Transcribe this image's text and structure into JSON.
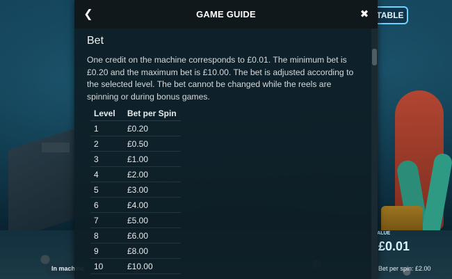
{
  "game": {
    "paytable_label": "TABLE",
    "bet_side_label": "VALUE",
    "bet_side_value": "£0.01",
    "in_machine_label": "In machine",
    "bet_per_spin_status": "Bet per spin: £2.00"
  },
  "modal": {
    "title": "GAME GUIDE",
    "back_icon": "chevron-left-icon",
    "close_icon": "close-icon",
    "section_title": "Bet",
    "paragraph": "One credit on the machine corresponds to £0.01. The minimum bet is £0.20 and the maximum bet is £10.00. The bet is adjusted according to the selected level. The bet cannot be changed while the reels are spinning or during bonus games.",
    "table": {
      "headers": [
        "Level",
        "Bet per Spin"
      ],
      "rows": [
        [
          "1",
          "£0.20"
        ],
        [
          "2",
          "£0.50"
        ],
        [
          "3",
          "£1.00"
        ],
        [
          "4",
          "£2.00"
        ],
        [
          "5",
          "£3.00"
        ],
        [
          "6",
          "£4.00"
        ],
        [
          "7",
          "£5.00"
        ],
        [
          "8",
          "£6.00"
        ],
        [
          "9",
          "£8.00"
        ],
        [
          "10",
          "£10.00"
        ]
      ]
    }
  },
  "colors": {
    "header_bg": "#11181c",
    "panel_bg": "#0e1e26",
    "accent": "#6fd3ff"
  }
}
